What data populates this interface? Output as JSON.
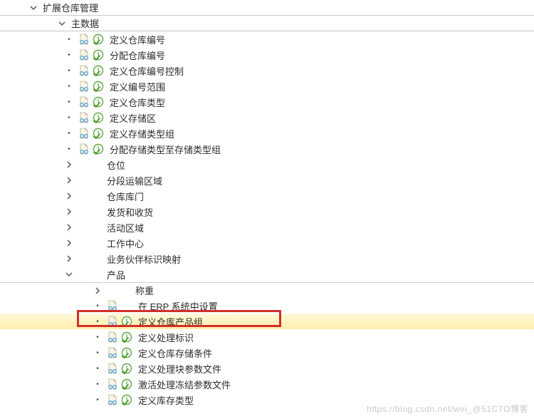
{
  "tree": {
    "level0": {
      "label": "扩展仓库管理"
    },
    "level1": {
      "label": "主数据"
    },
    "level2": [
      {
        "label": "定义仓库编号",
        "icons": true
      },
      {
        "label": "分配仓库编号",
        "icons": true
      },
      {
        "label": "定义仓库编号控制",
        "icons": true
      },
      {
        "label": "定义编号范围",
        "icons": true
      },
      {
        "label": "定义仓库类型",
        "icons": true
      },
      {
        "label": "定义存储区",
        "icons": true
      },
      {
        "label": "定义存储类型组",
        "icons": true
      },
      {
        "label": "分配存储类型至存储类型组",
        "icons": true
      },
      {
        "label": "仓位",
        "icons": false
      },
      {
        "label": "分段运输区域",
        "icons": false
      },
      {
        "label": "仓库库门",
        "icons": false
      },
      {
        "label": "发货和收货",
        "icons": false
      },
      {
        "label": "活动区域",
        "icons": false
      },
      {
        "label": "工作中心",
        "icons": false
      },
      {
        "label": "业务伙伴标识映射",
        "icons": false
      },
      {
        "label": "产品",
        "icons": false,
        "expanded": true
      }
    ],
    "level3": [
      {
        "label": "称重",
        "icons": false
      },
      {
        "label": "在 ERP 系统中设置",
        "icons": "doc-only"
      },
      {
        "label": "定义仓库产品组",
        "icons": true,
        "highlighted": true
      },
      {
        "label": "定义处理标识",
        "icons": true
      },
      {
        "label": "定义仓库存储条件",
        "icons": true
      },
      {
        "label": "定义处理块参数文件",
        "icons": true
      },
      {
        "label": "激活处理冻结参数文件",
        "icons": true
      },
      {
        "label": "定义库存类型",
        "icons": true
      }
    ]
  },
  "watermark": "https://blog.csdn.net/wei_@51CTO博客"
}
